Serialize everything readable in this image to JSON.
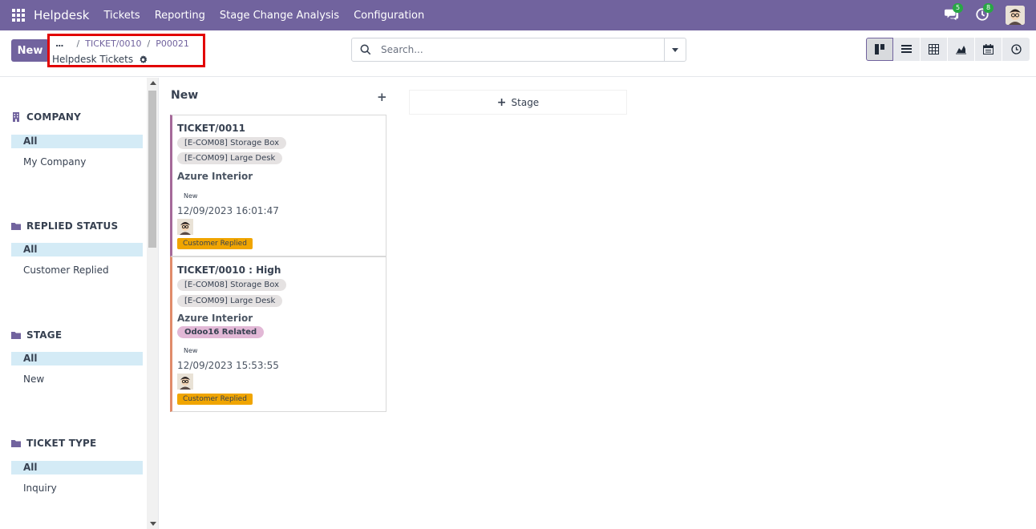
{
  "navbar": {
    "brand": "Helpdesk",
    "menu": [
      "Tickets",
      "Reporting",
      "Stage Change Analysis",
      "Configuration"
    ],
    "messages_count": "5",
    "activities_count": "8",
    "accent": "#71639e"
  },
  "control_panel": {
    "new_label": "New",
    "breadcrumb": {
      "dots": "...",
      "items": [
        "TICKET/0010",
        "P00021"
      ],
      "current": "Helpdesk Tickets"
    },
    "search": {
      "placeholder": "Search..."
    },
    "views": [
      "kanban-icon",
      "list-icon",
      "pivot-icon",
      "graph-icon",
      "calendar-icon",
      "activity-icon"
    ]
  },
  "sidebar": {
    "sections": [
      {
        "title": "COMPANY",
        "icon": "building-icon",
        "items": [
          "All",
          "My Company"
        ]
      },
      {
        "title": "REPLIED STATUS",
        "icon": "folder-icon",
        "items": [
          "All",
          "Customer Replied"
        ]
      },
      {
        "title": "STAGE",
        "icon": "folder-icon",
        "items": [
          "All",
          "New"
        ]
      },
      {
        "title": "TICKET TYPE",
        "icon": "folder-icon",
        "items": [
          "All",
          "Inquiry"
        ]
      }
    ]
  },
  "kanban": {
    "column_title": "New",
    "add_stage": "Stage",
    "cards": [
      {
        "title": "TICKET/0011",
        "tags": [
          "[E-COM08] Storage Box",
          "[E-COM09] Large Desk"
        ],
        "partner": "Azure Interior",
        "stage": "New",
        "date": "12/09/2023 16:01:47",
        "status": "Customer Replied"
      },
      {
        "title": "TICKET/0010 : High",
        "tags": [
          "[E-COM08] Storage Box",
          "[E-COM09] Large Desk"
        ],
        "partner": "Azure Interior",
        "label_tag": "Odoo16 Related",
        "stage": "New",
        "date": "12/09/2023 15:53:55",
        "status": "Customer Replied"
      }
    ]
  }
}
